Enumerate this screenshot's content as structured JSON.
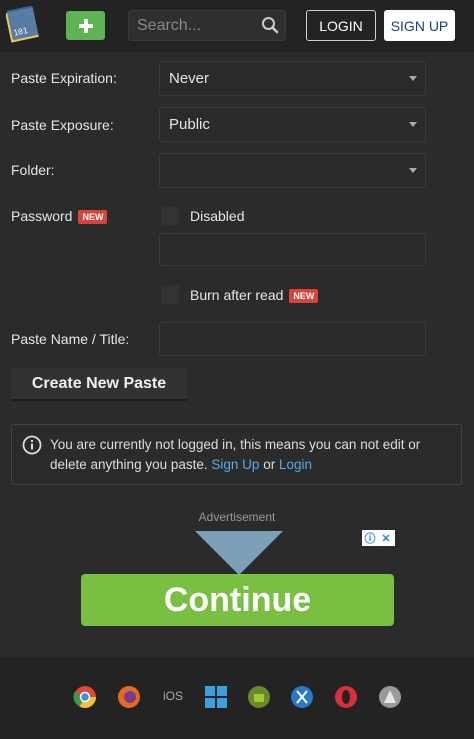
{
  "header": {
    "logo": "pastebin-logo",
    "add_button": "+",
    "search_placeholder": "Search...",
    "login_label": "LOGIN",
    "signup_label": "SIGN UP"
  },
  "form": {
    "expiration": {
      "label": "Paste Expiration:",
      "value": "Never"
    },
    "exposure": {
      "label": "Paste Exposure:",
      "value": "Public"
    },
    "folder": {
      "label": "Folder:",
      "value": ""
    },
    "password": {
      "label": "Password",
      "badge": "NEW",
      "checkbox_label": "Disabled"
    },
    "burn": {
      "label": "Burn after read",
      "badge": "NEW"
    },
    "title": {
      "label": "Paste Name / Title:"
    },
    "create_button": "Create New Paste"
  },
  "notice": {
    "text": "You are currently not logged in, this means you can not edit or delete anything you paste.",
    "signup_link": "Sign Up",
    "or": "or",
    "login_link": "Login"
  },
  "ad": {
    "label": "Advertisement",
    "continue_label": "Continue"
  },
  "footer": {
    "platforms": [
      "chrome",
      "firefox",
      "iOS",
      "windows",
      "android",
      "mac",
      "opera",
      "linux"
    ]
  },
  "colors": {
    "background": "#2b2b2b",
    "header": "#232323",
    "add_button": "#5fb354",
    "badge": "#d9443a",
    "link": "#5aa9e6",
    "continue": "#79c042"
  }
}
